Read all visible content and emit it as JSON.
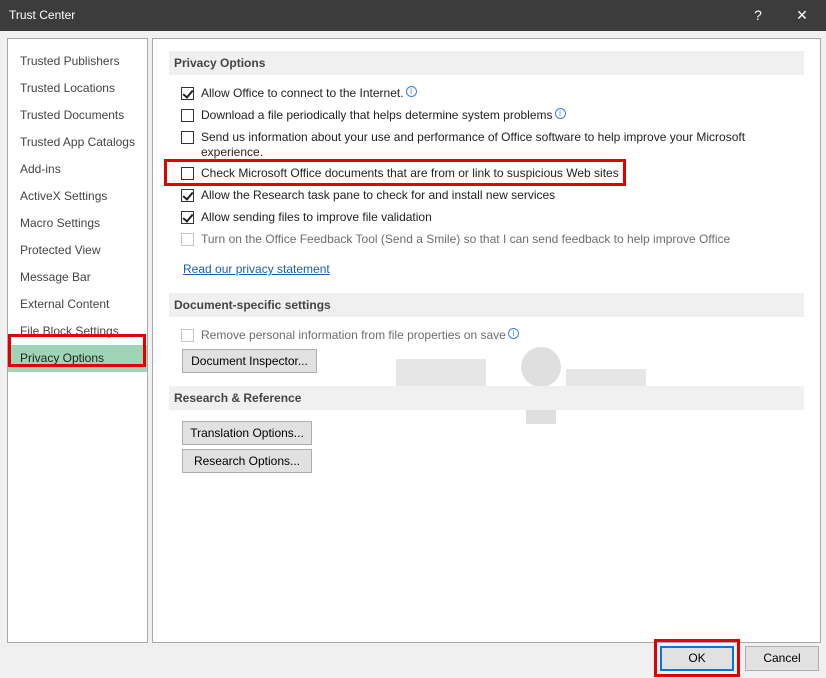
{
  "window": {
    "title": "Trust Center",
    "help_label": "?",
    "close_label": "✕"
  },
  "nav": {
    "items": [
      {
        "label": "Trusted Publishers"
      },
      {
        "label": "Trusted Locations"
      },
      {
        "label": "Trusted Documents"
      },
      {
        "label": "Trusted App Catalogs"
      },
      {
        "label": "Add-ins"
      },
      {
        "label": "ActiveX Settings"
      },
      {
        "label": "Macro Settings"
      },
      {
        "label": "Protected View"
      },
      {
        "label": "Message Bar"
      },
      {
        "label": "External Content"
      },
      {
        "label": "File Block Settings"
      },
      {
        "label": "Privacy Options"
      }
    ],
    "selected": "Privacy Options"
  },
  "privacy": {
    "header": "Privacy Options",
    "options": [
      {
        "label": "Allow Office to connect to the Internet.",
        "checked": true,
        "info": true
      },
      {
        "label": "Download a file periodically that helps determine system problems",
        "checked": false,
        "info": true
      },
      {
        "label": "Send us information about your use and performance of Office software to help improve your Microsoft experience.",
        "checked": false
      },
      {
        "label": "Check Microsoft Office documents that are from or link to suspicious Web sites",
        "checked": false
      },
      {
        "label": "Allow the Research task pane to check for and install new services",
        "checked": true
      },
      {
        "label": "Allow sending files to improve file validation",
        "checked": true
      },
      {
        "label": "Turn on the Office Feedback Tool (Send a Smile) so that I can send feedback to help improve Office",
        "checked": false,
        "disabled": true
      }
    ],
    "privacy_link": "Read our privacy statement"
  },
  "document": {
    "header": "Document-specific settings",
    "remove_info_label": "Remove personal information from file properties on save",
    "inspector_button": "Document Inspector..."
  },
  "research": {
    "header": "Research & Reference",
    "translation_button": "Translation Options...",
    "research_button": "Research Options..."
  },
  "footer": {
    "ok_label": "OK",
    "cancel_label": "Cancel"
  },
  "colors": {
    "selected_nav": "#9fd5b7",
    "highlight": "#e00000",
    "link": "#1a5db4",
    "titlebar": "#3c3c3c"
  }
}
